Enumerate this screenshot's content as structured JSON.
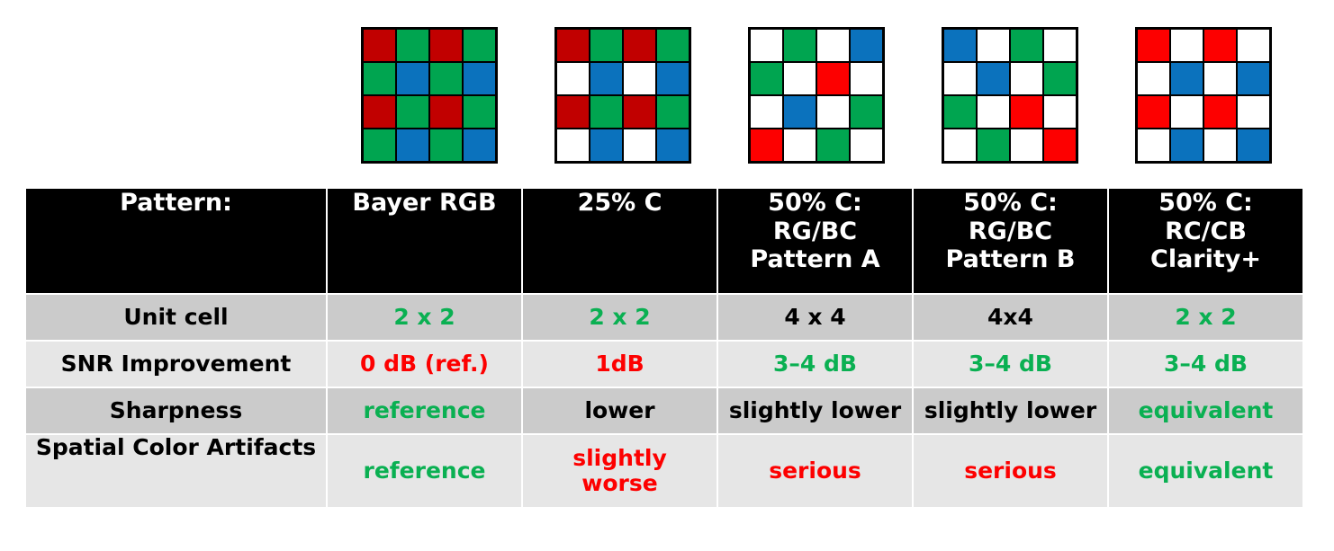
{
  "colors": {
    "green": "#0ab052",
    "red": "#fd0000",
    "black": "#000000",
    "header_bg": "#000000",
    "row_dark_bg": "#cbcbcb",
    "row_light_bg": "#e6e6e6",
    "cfa_red_dark": "#c10000",
    "cfa_red_bright": "#fd0000",
    "cfa_green": "#00a550",
    "cfa_blue": "#0b72bd",
    "cfa_white": "#ffffff"
  },
  "patterns": [
    {
      "name": "bayer-rgb-pattern",
      "grid": [
        [
          "R",
          "G",
          "R",
          "G"
        ],
        [
          "G",
          "B",
          "G",
          "B"
        ],
        [
          "R",
          "G",
          "R",
          "G"
        ],
        [
          "G",
          "B",
          "G",
          "B"
        ]
      ],
      "red_tone": "dark"
    },
    {
      "name": "25-percent-clear-pattern",
      "grid": [
        [
          "R",
          "G",
          "R",
          "G"
        ],
        [
          "W",
          "B",
          "W",
          "B"
        ],
        [
          "R",
          "G",
          "R",
          "G"
        ],
        [
          "W",
          "B",
          "W",
          "B"
        ]
      ],
      "red_tone": "dark"
    },
    {
      "name": "50-percent-clear-rgbc-pattern-a",
      "grid": [
        [
          "W",
          "G",
          "W",
          "B"
        ],
        [
          "G",
          "W",
          "R",
          "W"
        ],
        [
          "W",
          "B",
          "W",
          "G"
        ],
        [
          "R",
          "W",
          "G",
          "W"
        ]
      ],
      "red_tone": "bright"
    },
    {
      "name": "50-percent-clear-rgbc-pattern-b",
      "grid": [
        [
          "B",
          "W",
          "G",
          "W"
        ],
        [
          "W",
          "B",
          "W",
          "G"
        ],
        [
          "G",
          "W",
          "R",
          "W"
        ],
        [
          "W",
          "G",
          "W",
          "R"
        ]
      ],
      "red_tone": "bright"
    },
    {
      "name": "50-percent-clear-rccb-clarity-plus",
      "grid": [
        [
          "R",
          "W",
          "R",
          "W"
        ],
        [
          "W",
          "B",
          "W",
          "B"
        ],
        [
          "R",
          "W",
          "R",
          "W"
        ],
        [
          "W",
          "B",
          "W",
          "B"
        ]
      ],
      "red_tone": "bright"
    }
  ],
  "table": {
    "header": {
      "label": "Pattern:",
      "columns": [
        {
          "lines": [
            "Bayer RGB"
          ]
        },
        {
          "lines": [
            "25% C"
          ]
        },
        {
          "lines": [
            "50% C:",
            "RG/BC",
            "Pattern A"
          ]
        },
        {
          "lines": [
            "50% C:",
            "RG/BC",
            "Pattern B"
          ]
        },
        {
          "lines": [
            "50% C:",
            "RC/CB",
            "Clarity+"
          ]
        }
      ]
    },
    "rows": [
      {
        "label": "Unit cell",
        "cells": [
          {
            "text": "2 x 2",
            "color": "green"
          },
          {
            "text": "2 x 2",
            "color": "green"
          },
          {
            "text": "4 x 4",
            "color": "black"
          },
          {
            "text": "4x4",
            "color": "black"
          },
          {
            "text": "2 x 2",
            "color": "green"
          }
        ]
      },
      {
        "label": "SNR Improvement",
        "cells": [
          {
            "text": "0 dB (ref.)",
            "color": "red"
          },
          {
            "text": "1dB",
            "color": "red"
          },
          {
            "text": "3–4 dB",
            "color": "green"
          },
          {
            "text": "3–4 dB",
            "color": "green"
          },
          {
            "text": "3–4 dB",
            "color": "green"
          }
        ]
      },
      {
        "label": "Sharpness",
        "cells": [
          {
            "text": "reference",
            "color": "green"
          },
          {
            "text": "lower",
            "color": "black"
          },
          {
            "text": "slightly lower",
            "color": "black"
          },
          {
            "text": "slightly lower",
            "color": "black"
          },
          {
            "text": "equivalent",
            "color": "green"
          }
        ]
      },
      {
        "label": "Spatial Color Artifacts",
        "cells": [
          {
            "text": "reference",
            "color": "green"
          },
          {
            "text": "slightly\nworse",
            "color": "red"
          },
          {
            "text": "serious",
            "color": "red"
          },
          {
            "text": "serious",
            "color": "red"
          },
          {
            "text": "equivalent",
            "color": "green"
          }
        ]
      }
    ]
  }
}
